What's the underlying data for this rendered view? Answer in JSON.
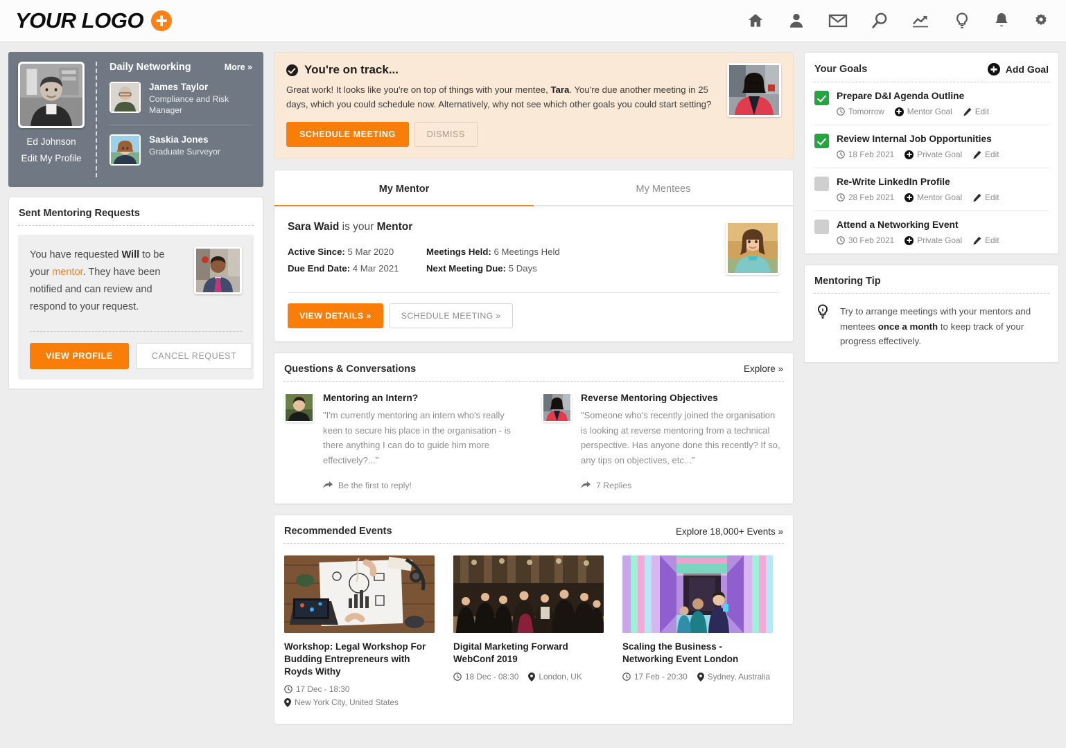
{
  "header": {
    "logo_text": "YOUR LOGO",
    "nav_icons": [
      "home-icon",
      "person-icon",
      "envelope-icon",
      "search-icon",
      "trending-chart-icon",
      "lightbulb-icon",
      "bell-icon",
      "gear-icon"
    ]
  },
  "profile": {
    "name": "Ed Johnson",
    "edit_link": "Edit My Profile"
  },
  "networking": {
    "title": "Daily Networking",
    "more_link": "More »",
    "people": [
      {
        "name": "James Taylor",
        "role": "Compliance and Risk Manager"
      },
      {
        "name": "Saskia Jones",
        "role": "Graduate Surveyor"
      }
    ]
  },
  "sent_requests": {
    "title": "Sent Mentoring Requests",
    "text_1": "You have requested ",
    "text_bold": "Will",
    "text_2": " to be your ",
    "text_link": "mentor",
    "text_3": ". They have been notified and can review and respond to your request.",
    "view_profile_label": "VIEW PROFILE",
    "cancel_label": "CANCEL REQUEST"
  },
  "banner": {
    "title": "You're on track...",
    "body_1": "Great work! It looks like you're on top of things with your mentee, ",
    "body_bold": "Tara",
    "body_2": ". You're due another meeting in 25 days, which you could schedule now. Alternatively, why not see which other goals you could start setting?",
    "primary_label": "SCHEDULE MEETING",
    "dismiss_label": "DISMISS"
  },
  "mentor_panel": {
    "tabs": [
      {
        "label": "My Mentor",
        "active": true
      },
      {
        "label": "My Mentees",
        "active": false
      }
    ],
    "name": "Sara Waid",
    "is_your": " is your ",
    "role": "Mentor",
    "fields": [
      {
        "label": "Active Since:",
        "value": " 5 Mar 2020"
      },
      {
        "label": "Due End Date:",
        "value": " 4 Mar 2021"
      },
      {
        "label": "Meetings Held:",
        "value": " 6 Meetings Held"
      },
      {
        "label": "Next Meeting Due:",
        "value": " 5 Days"
      }
    ],
    "view_details_label": "VIEW DETAILS »",
    "schedule_label": "SCHEDULE MEETING »"
  },
  "questions": {
    "title": "Questions & Conversations",
    "explore_link": "Explore »",
    "items": [
      {
        "title": "Mentoring an Intern?",
        "quote": "\"I'm currently mentoring an intern who's really keen to secure his place in the organisation - is there anything I can do to guide him more effectively?...\"",
        "replies": "Be the first to reply!"
      },
      {
        "title": "Reverse Mentoring Objectives",
        "quote": "\"Someone who's recently joined the organisation is looking at reverse mentoring from a technical perspective. Has anyone done this recently? If so, any tips on objectives, etc...\"",
        "replies": "7 Replies"
      }
    ]
  },
  "events": {
    "title": "Recommended Events",
    "explore_link": "Explore 18,000+ Events »",
    "items": [
      {
        "title": "Workshop: Legal Workshop For Budding Entrepreneurs with Royds Withy",
        "date": "17 Dec - 18:30",
        "location": "New York City, United States"
      },
      {
        "title": "Digital Marketing Forward WebConf 2019",
        "date": "18 Dec - 08:30",
        "location": "London, UK"
      },
      {
        "title": "Scaling the Business - Networking Event London",
        "date": "17 Feb - 20:30",
        "location": "Sydney, Australia"
      }
    ]
  },
  "goals": {
    "title": "Your Goals",
    "add_label": "Add Goal",
    "edit_label": "Edit",
    "items": [
      {
        "name": "Prepare D&I Agenda Outline",
        "date": "Tomorrow",
        "type": "Mentor Goal",
        "done": true
      },
      {
        "name": "Review Internal Job Opportunities",
        "date": "18 Feb 2021",
        "type": "Private Goal",
        "done": true
      },
      {
        "name": "Re-Write LinkedIn Profile",
        "date": "28 Feb 2021",
        "type": "Mentor Goal",
        "done": false
      },
      {
        "name": "Attend a Networking Event",
        "date": "30 Feb 2021",
        "type": "Private Goal",
        "done": false
      }
    ]
  },
  "tip": {
    "title": "Mentoring Tip",
    "text_1": "Try to arrange meetings with your mentors and mentees ",
    "text_bold": "once a month",
    "text_2": " to keep track of your progress effectively."
  },
  "colors": {
    "orange": "#f97d09",
    "green": "#23a63f",
    "banner_bg": "#fbe9d7",
    "sidebar_gray": "#6f7883",
    "page_bg": "#ededed"
  }
}
